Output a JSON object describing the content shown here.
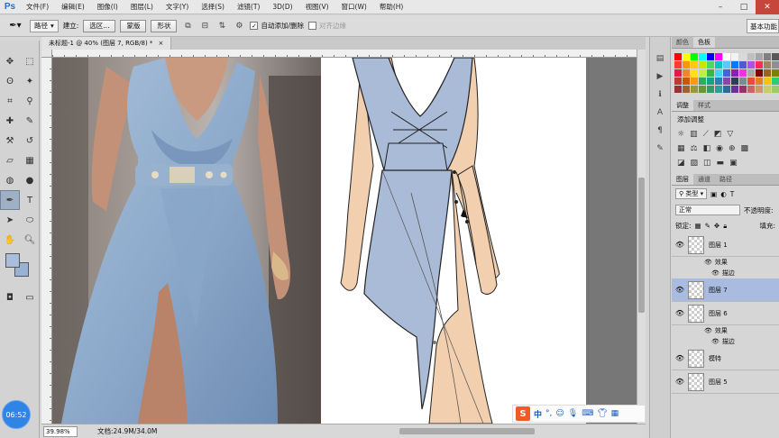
{
  "menubar": {
    "logo": "Ps",
    "items": [
      "文件(F)",
      "编辑(E)",
      "图像(I)",
      "图层(L)",
      "文字(Y)",
      "选择(S)",
      "滤镜(T)",
      "3D(D)",
      "视图(V)",
      "窗口(W)",
      "帮助(H)"
    ]
  },
  "options": {
    "path_mode": "路径",
    "make_label": "建立:",
    "selection_btn": "选区...",
    "mask_btn": "蒙版",
    "shape_btn": "形状",
    "auto_add_delete": "自动添加/删除",
    "align_edges": "对齐边缘",
    "workspace": "基本功能"
  },
  "document": {
    "tab_title": "未标题-1 @ 40% (图层 7, RGB/8) *",
    "zoom": "39.98%",
    "doc_size": "文档:24.9M/34.0M"
  },
  "panels": {
    "color_tabs": [
      "颜色",
      "色板"
    ],
    "adjust_tabs": [
      "调整",
      "样式"
    ],
    "adjust_title": "添加调整",
    "layer_tabs": [
      "图层",
      "通道",
      "路径"
    ],
    "filter_kind": "类型",
    "blend_mode": "正常",
    "opacity_label": "不透明度:",
    "lock_label": "锁定:",
    "fill_label": "填充:",
    "layers": [
      {
        "name": "图层 1",
        "selected": false
      },
      {
        "name": "图层 7",
        "selected": true
      },
      {
        "name": "图层 6",
        "selected": false
      },
      {
        "name": "模特",
        "selected": false
      },
      {
        "name": "图层 5",
        "selected": false
      }
    ],
    "effects_label": "效果",
    "stroke_label": "描边"
  },
  "ime": {
    "logo": "S",
    "lang": "中"
  },
  "clock": "06:52",
  "swatch_colors": [
    "#ff0000",
    "#ffff00",
    "#00ff00",
    "#00ffff",
    "#0000ff",
    "#ff00ff",
    "#ffffff",
    "#f2f2f2",
    "#d9d9d9",
    "#bfbfbf",
    "#a6a6a6",
    "#808080",
    "#595959",
    "#000000",
    "#ff3b30",
    "#ff9500",
    "#ffcc00",
    "#c8e600",
    "#4cd964",
    "#00c7be",
    "#5ac8fa",
    "#007aff",
    "#5856d6",
    "#af52de",
    "#ff2d55",
    "#a2845e",
    "#8e8e93",
    "#3a3a3c",
    "#e6194b",
    "#f58231",
    "#ffe119",
    "#bfef45",
    "#3cb44b",
    "#42d4f4",
    "#4363d8",
    "#911eb4",
    "#f032e6",
    "#a9a9a9",
    "#800000",
    "#9a6324",
    "#808000",
    "#469990",
    "#c0392b",
    "#d35400",
    "#f39c12",
    "#27ae60",
    "#16a085",
    "#2980b9",
    "#8e44ad",
    "#2c3e50",
    "#7f8c8d",
    "#e74c3c",
    "#e67e22",
    "#f1c40f",
    "#2ecc71",
    "#1abc9c",
    "#993333",
    "#996633",
    "#999933",
    "#669933",
    "#339966",
    "#339999",
    "#336699",
    "#663399",
    "#993366",
    "#cc6666",
    "#cc9966",
    "#cccc66",
    "#99cc66",
    "#66cc99"
  ]
}
